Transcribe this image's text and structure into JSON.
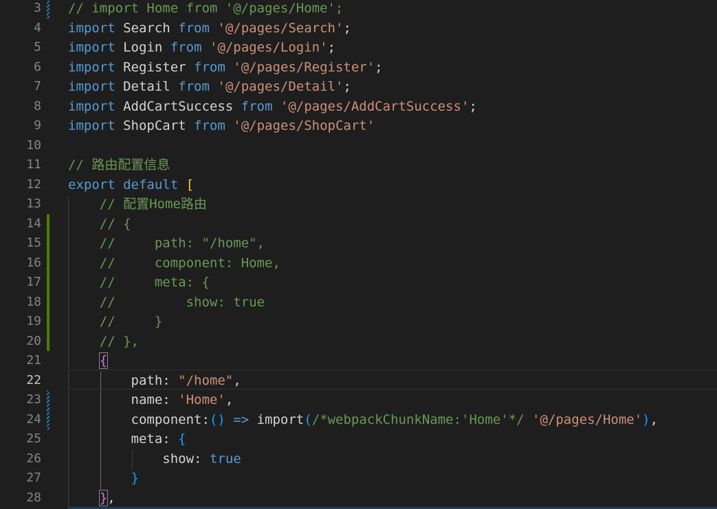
{
  "editor": {
    "theme": "dark",
    "colors": {
      "background": "#1e1e1e",
      "keyword": "#569cd6",
      "string": "#ce9178",
      "comment": "#6a9955",
      "bracket_gold": "#ffd700",
      "bracket_purple": "#da70d6",
      "bracket_blue": "#179fff",
      "gutter_modified": "#487e02"
    },
    "current_line": "22",
    "lines": [
      {
        "n": "3",
        "text": "// import Home from '@/pages/Home';"
      },
      {
        "n": "4",
        "text": "import Search from '@/pages/Search';"
      },
      {
        "n": "5",
        "text": "import Login from '@/pages/Login';"
      },
      {
        "n": "6",
        "text": "import Register from '@/pages/Register';"
      },
      {
        "n": "7",
        "text": "import Detail from '@/pages/Detail';"
      },
      {
        "n": "8",
        "text": "import AddCartSuccess from '@/pages/AddCartSuccess';"
      },
      {
        "n": "9",
        "text": "import ShopCart from '@/pages/ShopCart'"
      },
      {
        "n": "10",
        "text": ""
      },
      {
        "n": "11",
        "text": "// 路由配置信息"
      },
      {
        "n": "12",
        "text": "export default ["
      },
      {
        "n": "13",
        "text": "    // 配置Home路由"
      },
      {
        "n": "14",
        "text": "    // {"
      },
      {
        "n": "15",
        "text": "    //     path: \"/home\","
      },
      {
        "n": "16",
        "text": "    //     component: Home,"
      },
      {
        "n": "17",
        "text": "    //     meta: {"
      },
      {
        "n": "18",
        "text": "    //         show: true"
      },
      {
        "n": "19",
        "text": "    //     }"
      },
      {
        "n": "20",
        "text": "    // },"
      },
      {
        "n": "21",
        "text": "    {"
      },
      {
        "n": "22",
        "text": "        path: \"/home\","
      },
      {
        "n": "23",
        "text": "        name: 'Home',"
      },
      {
        "n": "24",
        "text": "        component:() => import(/*webpackChunkName:'Home'*/ '@/pages/Home'),"
      },
      {
        "n": "25",
        "text": "        meta: {"
      },
      {
        "n": "26",
        "text": "            show: true"
      },
      {
        "n": "27",
        "text": "        }"
      },
      {
        "n": "28",
        "text": "    },"
      }
    ]
  }
}
